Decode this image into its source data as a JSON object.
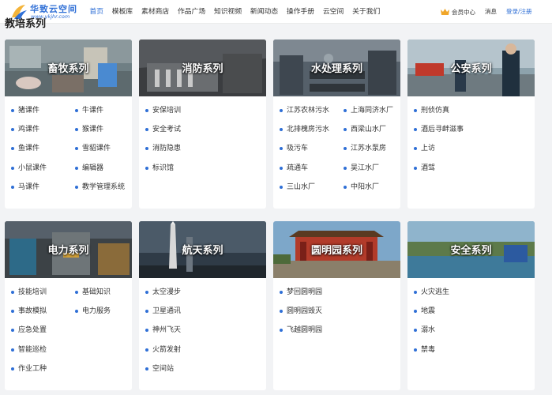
{
  "logo": {
    "name": "华致云空间",
    "url": "www.ykjhr.com"
  },
  "nav": [
    "首页",
    "模板库",
    "素材商店",
    "作品广场",
    "知识视频",
    "新闻动态",
    "操作手册",
    "云空间",
    "关于我们"
  ],
  "header_right": {
    "member": "会员中心",
    "messages": "消息",
    "login": "登录/注册"
  },
  "section_title": "教培系列",
  "colors": {
    "accent": "#2f6fd6"
  },
  "cards": [
    {
      "title": "畜牧系列",
      "items": [
        "猪课件",
        "牛课件",
        "鸡课件",
        "猴课件",
        "鱼课件",
        "雪貂课件",
        "小鼠课件",
        "编辑器",
        "马课件",
        "教学管理系统"
      ]
    },
    {
      "title": "消防系列",
      "items": [
        "安保培训",
        "安全考试",
        "消防隐患",
        "标识馆"
      ]
    },
    {
      "title": "水处理系列",
      "items": [
        "江苏农林污水",
        "上海同济水厂",
        "北排槐房污水",
        "西梁山水厂",
        "吸污车",
        "江苏水泵房",
        "疏通车",
        "吴江水厂",
        "三山水厂",
        "中阳水厂"
      ]
    },
    {
      "title": "公安系列",
      "items": [
        "刑侦仿真",
        "酒后寻衅滋事",
        "上访",
        "酒驾"
      ]
    },
    {
      "title": "电力系列",
      "items": [
        "技能培训",
        "基础知识",
        "事故模拟",
        "电力服务",
        "应急处置",
        "智能巡检",
        "作业工种"
      ]
    },
    {
      "title": "航天系列",
      "items": [
        "太空漫步",
        "卫星通讯",
        "神州飞天",
        "火箭发射",
        "空间站"
      ]
    },
    {
      "title": "圆明园系列",
      "items": [
        "梦回圆明园",
        "圆明园毁灭",
        "飞越圆明园"
      ]
    },
    {
      "title": "安全系列",
      "items": [
        "火灾逃生",
        "地震",
        "溺水",
        "禁毒"
      ]
    }
  ]
}
